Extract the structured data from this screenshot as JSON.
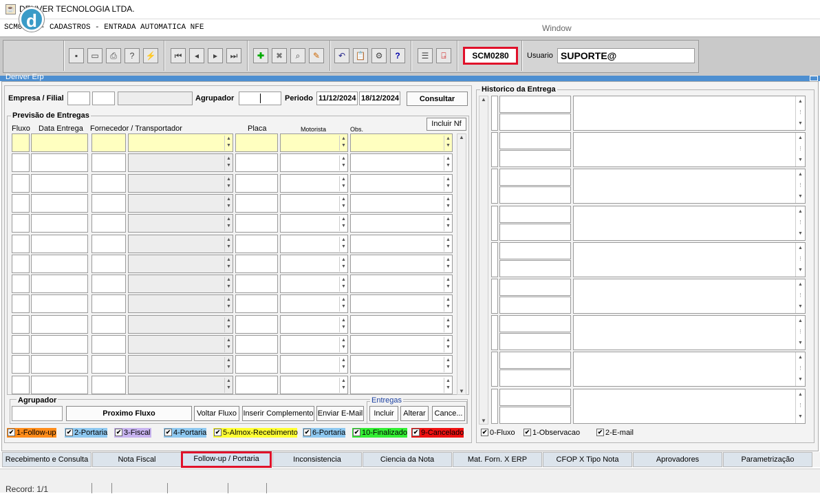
{
  "window": {
    "title": "DENVER TECNOLOGIA LTDA."
  },
  "menubar": {
    "form_title": "SCM0280 - CADASTROS - ENTRADA AUTOMATICA NFE",
    "window_menu": "Window"
  },
  "toolbar": {
    "logo": "d",
    "form_code": "SCM0280",
    "user_label": "Usuario",
    "user_value": "SUPORTE@"
  },
  "inner_window_title": "Denver Erp",
  "header": {
    "empresa_label": "Empresa / Filial",
    "agrupador_label": "Agrupador",
    "periodo_label": "Periodo",
    "date_from": "11/12/2024",
    "date_to": "18/12/2024",
    "consultar": "Consultar"
  },
  "previsao": {
    "title": "Previsão de Entregas",
    "incluir_nf": "Incluir Nf",
    "columns": {
      "fluxo": "Fluxo",
      "data_entrega": "Data Entrega",
      "fornecedor": "Fornecedor / Transportador",
      "placa": "Placa",
      "motorista": "Motorista",
      "obs": "Obs."
    }
  },
  "bottom": {
    "agrupador_label": "Agrupador",
    "proximo_fluxo": "Proximo Fluxo",
    "voltar_fluxo": "Voltar Fluxo",
    "inserir_complemento": "Inserir Complemento",
    "enviar_email": "Enviar E-Mail",
    "entregas_label": "Entregas",
    "incluir": "Incluir",
    "alterar": "Alterar",
    "cancelar": "Cance..."
  },
  "legend": [
    {
      "label": "1-Follow-up",
      "color": "#ff8c1a"
    },
    {
      "label": "2-Portaria",
      "color": "#8ec8f0"
    },
    {
      "label": "3-Fiscal",
      "color": "#c8b4f0"
    },
    {
      "label": "4-Portaria",
      "color": "#8ec8f0"
    },
    {
      "label": "5-Almox-Recebimento",
      "color": "#ffff33"
    },
    {
      "label": "6-Portaria",
      "color": "#8ec8f0"
    },
    {
      "label": "10-Finalizado",
      "color": "#33ee33"
    },
    {
      "label": "9-Cancelado",
      "color": "#ee1111"
    }
  ],
  "historico": {
    "title": "Historico da Entrega",
    "checks": [
      "0-Fluxo",
      "1-Observacao",
      "2-E-mail"
    ]
  },
  "tabs": [
    "Recebimento e Consulta",
    "Nota Fiscal",
    "Follow-up / Portaria",
    "Inconsistencia",
    "Ciencia da Nota",
    "Mat. Forn. X ERP",
    "CFOP X Tipo Nota",
    "Aprovadores",
    "Parametrização"
  ],
  "status": {
    "record": "Record: 1/1"
  }
}
